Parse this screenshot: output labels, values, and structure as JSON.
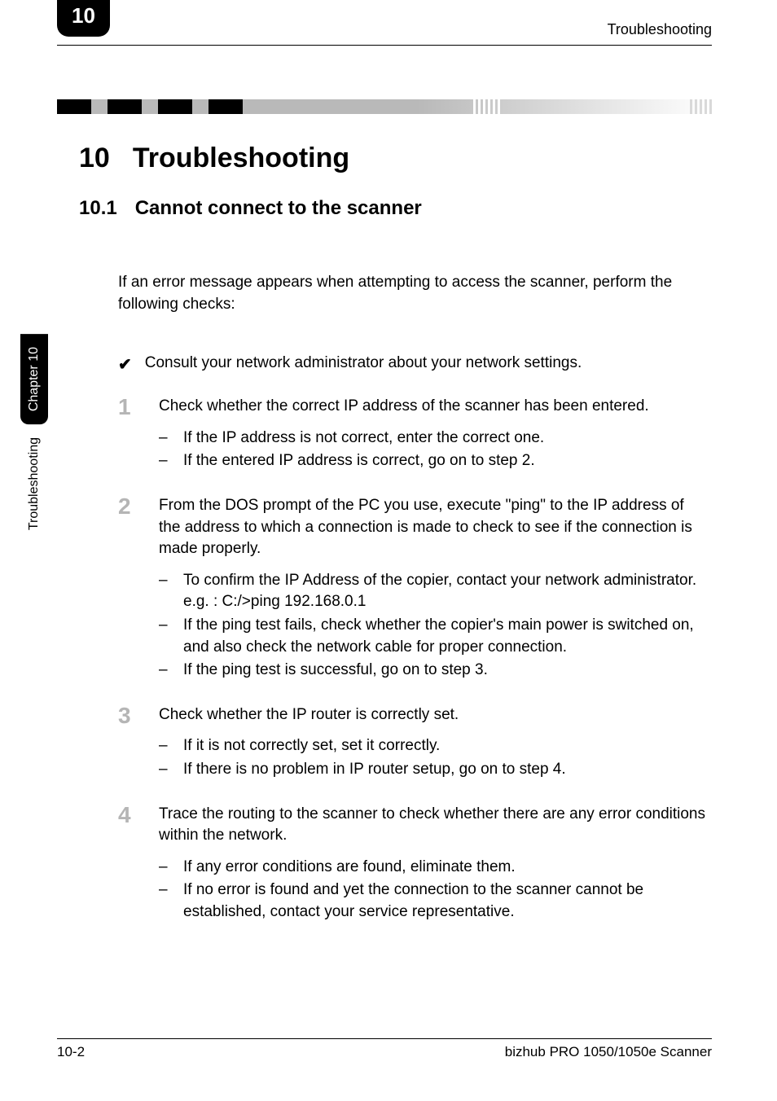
{
  "header": {
    "chapter_number": "10",
    "title": "Troubleshooting"
  },
  "side_tab": {
    "chapter_label": "Chapter 10",
    "section_label": "Troubleshooting"
  },
  "h1": {
    "number": "10",
    "text": "Troubleshooting"
  },
  "h2": {
    "number": "10.1",
    "text": "Cannot connect to the scanner"
  },
  "intro": "If an error message appears when attempting to access the scanner, perform the following checks:",
  "checkmark": "Consult your network administrator about your network settings.",
  "steps": [
    {
      "num": "1",
      "text": "Check whether the correct IP address of the scanner has been entered.",
      "items": [
        "If the IP address is not correct, enter the correct one.",
        "If the entered IP address is correct, go on to step 2."
      ]
    },
    {
      "num": "2",
      "text": "From the DOS prompt of the PC you use, execute \"ping\" to the IP address of the address to which a connection is made to check to see if the connection is made properly.",
      "items": [
        "To confirm the IP Address of the copier, contact your network administrator.\ne.g. : C:/>ping 192.168.0.1",
        "If the ping test fails, check whether the copier's main power is switched on, and also check the network cable for proper connection.",
        "If the ping test is successful, go on to step 3."
      ]
    },
    {
      "num": "3",
      "text": "Check whether the IP router is correctly set.",
      "items": [
        "If it is not correctly set, set it correctly.",
        "If there is no problem in IP router setup, go on to step 4."
      ]
    },
    {
      "num": "4",
      "text": "Trace the routing to the scanner to check whether there are any error conditions within the network.",
      "items": [
        "If any error conditions are found, eliminate them.",
        "If no error is found and yet the connection to the scanner cannot be established, contact your service representative."
      ]
    }
  ],
  "footer": {
    "left": "10-2",
    "right": "bizhub PRO 1050/1050e Scanner"
  }
}
